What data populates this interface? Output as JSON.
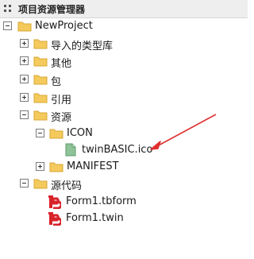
{
  "panel": {
    "title": "项目资源管理器",
    "grip_icon": "grid-grip-icon"
  },
  "tree": {
    "root_label": "NewProject",
    "import_types_label": "导入的类型库",
    "other_label": "其他",
    "packages_label": "包",
    "references_label": "引用",
    "resources_label": "资源",
    "icon_folder_label": "ICON",
    "ico_file_label": "twinBASIC.ico",
    "manifest_label": "MANIFEST",
    "source_label": "源代码",
    "form_tbform_label": "Form1.tbform",
    "form_twin_label": "Form1.twin"
  },
  "colors": {
    "folder": "#f4ca5c",
    "arrow": "#e03030",
    "twin_icon": "#d8232a",
    "ico_file": "#8fc49a"
  }
}
